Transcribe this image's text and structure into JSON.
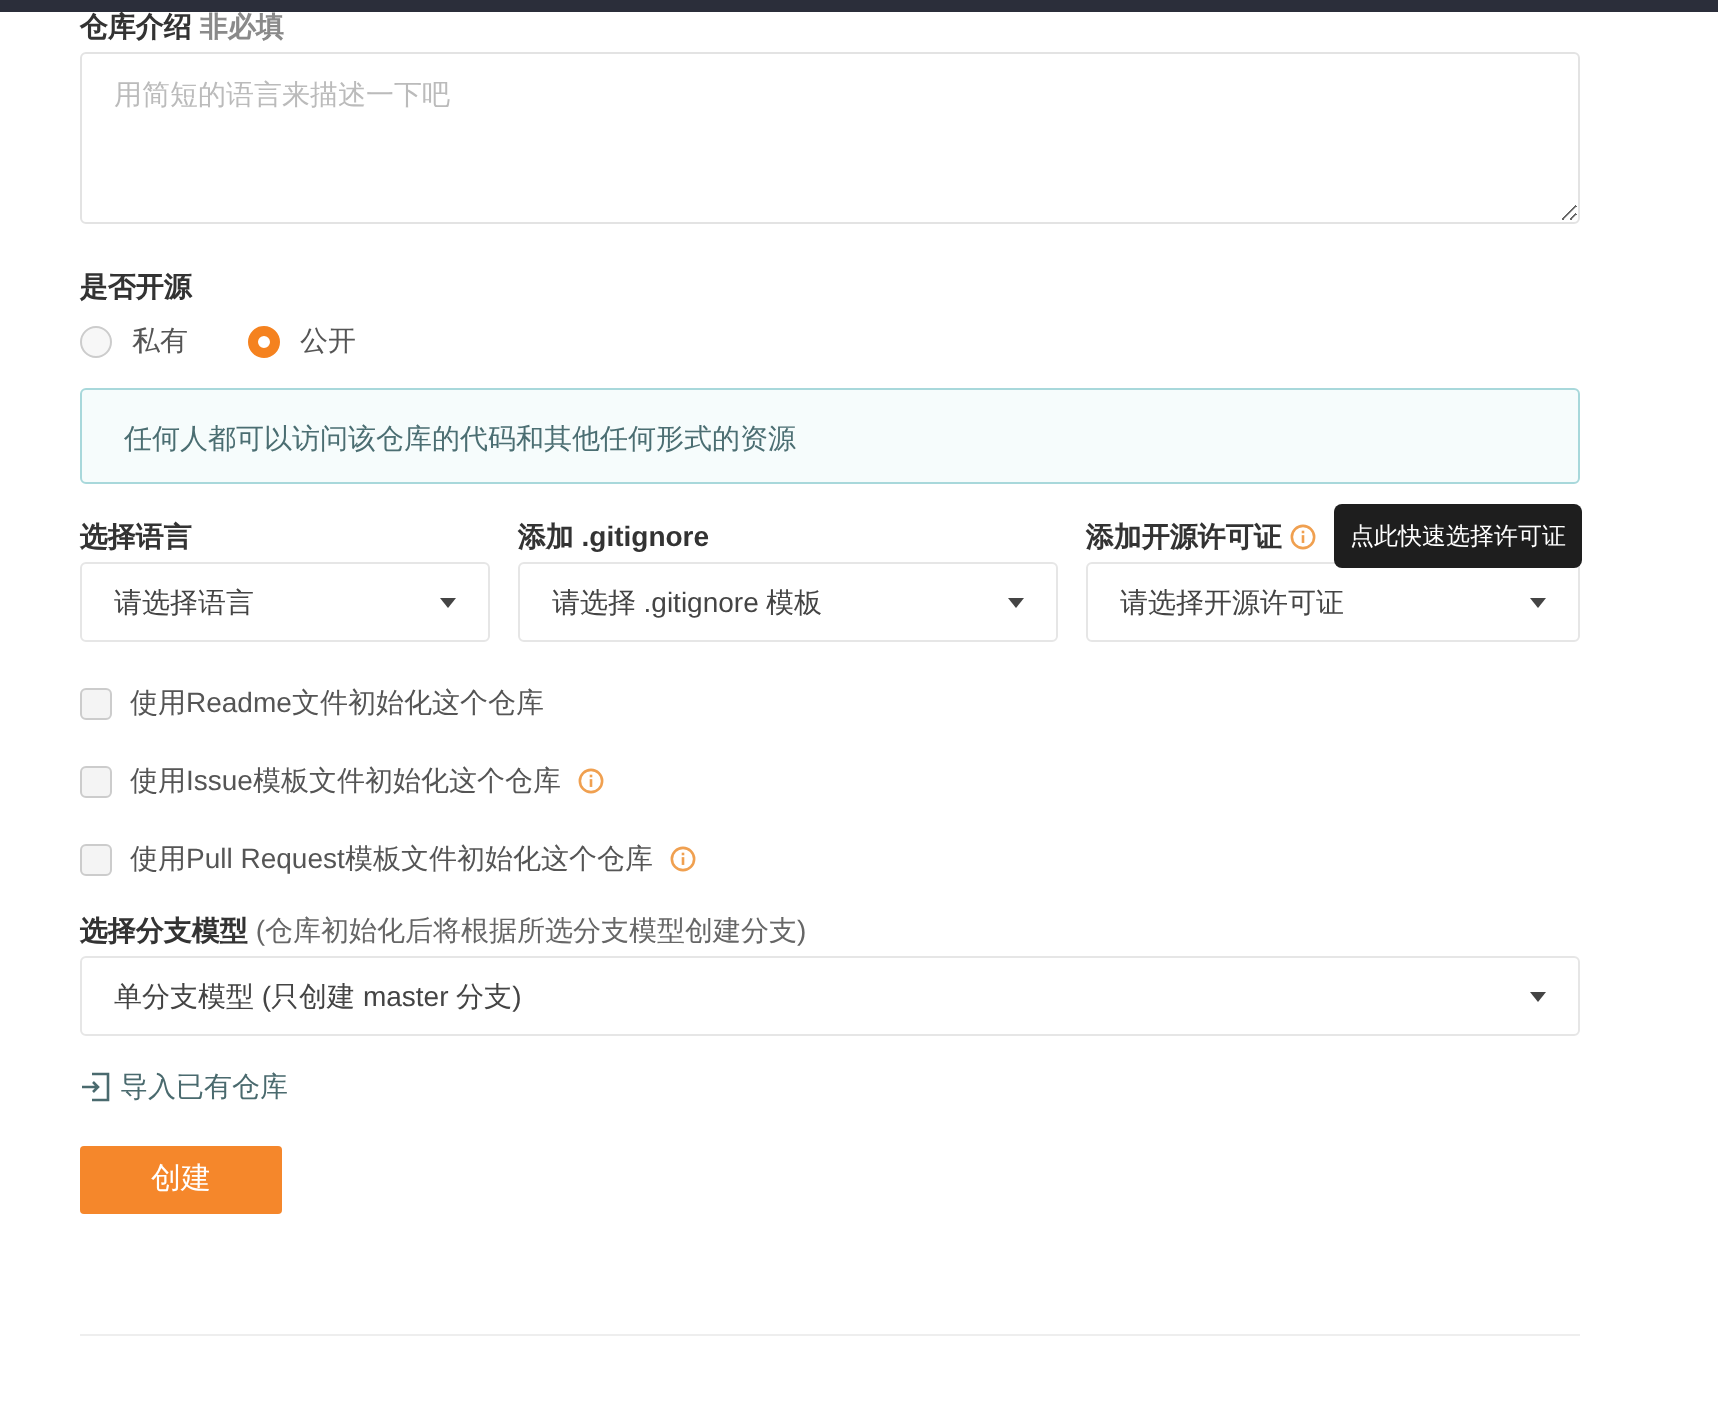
{
  "description": {
    "label": "仓库介绍",
    "hint": "非必填",
    "placeholder": "用简短的语言来描述一下吧"
  },
  "visibility": {
    "label": "是否开源",
    "options": [
      {
        "label": "私有",
        "selected": false
      },
      {
        "label": "公开",
        "selected": true
      }
    ],
    "notice": "任何人都可以访问该仓库的代码和其他任何形式的资源"
  },
  "selects": [
    {
      "label": "选择语言",
      "value": "请选择语言",
      "info": false
    },
    {
      "label": "添加 .gitignore",
      "value": "请选择 .gitignore 模板",
      "info": false
    },
    {
      "label": "添加开源许可证",
      "value": "请选择开源许可证",
      "info": true,
      "tooltip": "点此快速选择许可证"
    }
  ],
  "checkboxes": [
    {
      "label": "使用Readme文件初始化这个仓库",
      "checked": false,
      "info": false
    },
    {
      "label": "使用Issue模板文件初始化这个仓库",
      "checked": false,
      "info": true
    },
    {
      "label": "使用Pull Request模板文件初始化这个仓库",
      "checked": false,
      "info": true
    }
  ],
  "branch_model": {
    "label": "选择分支模型",
    "note": "(仓库初始化后将根据所选分支模型创建分支)",
    "value": "单分支模型 (只创建 master 分支)"
  },
  "import_link": "导入已有仓库",
  "submit": "创建"
}
